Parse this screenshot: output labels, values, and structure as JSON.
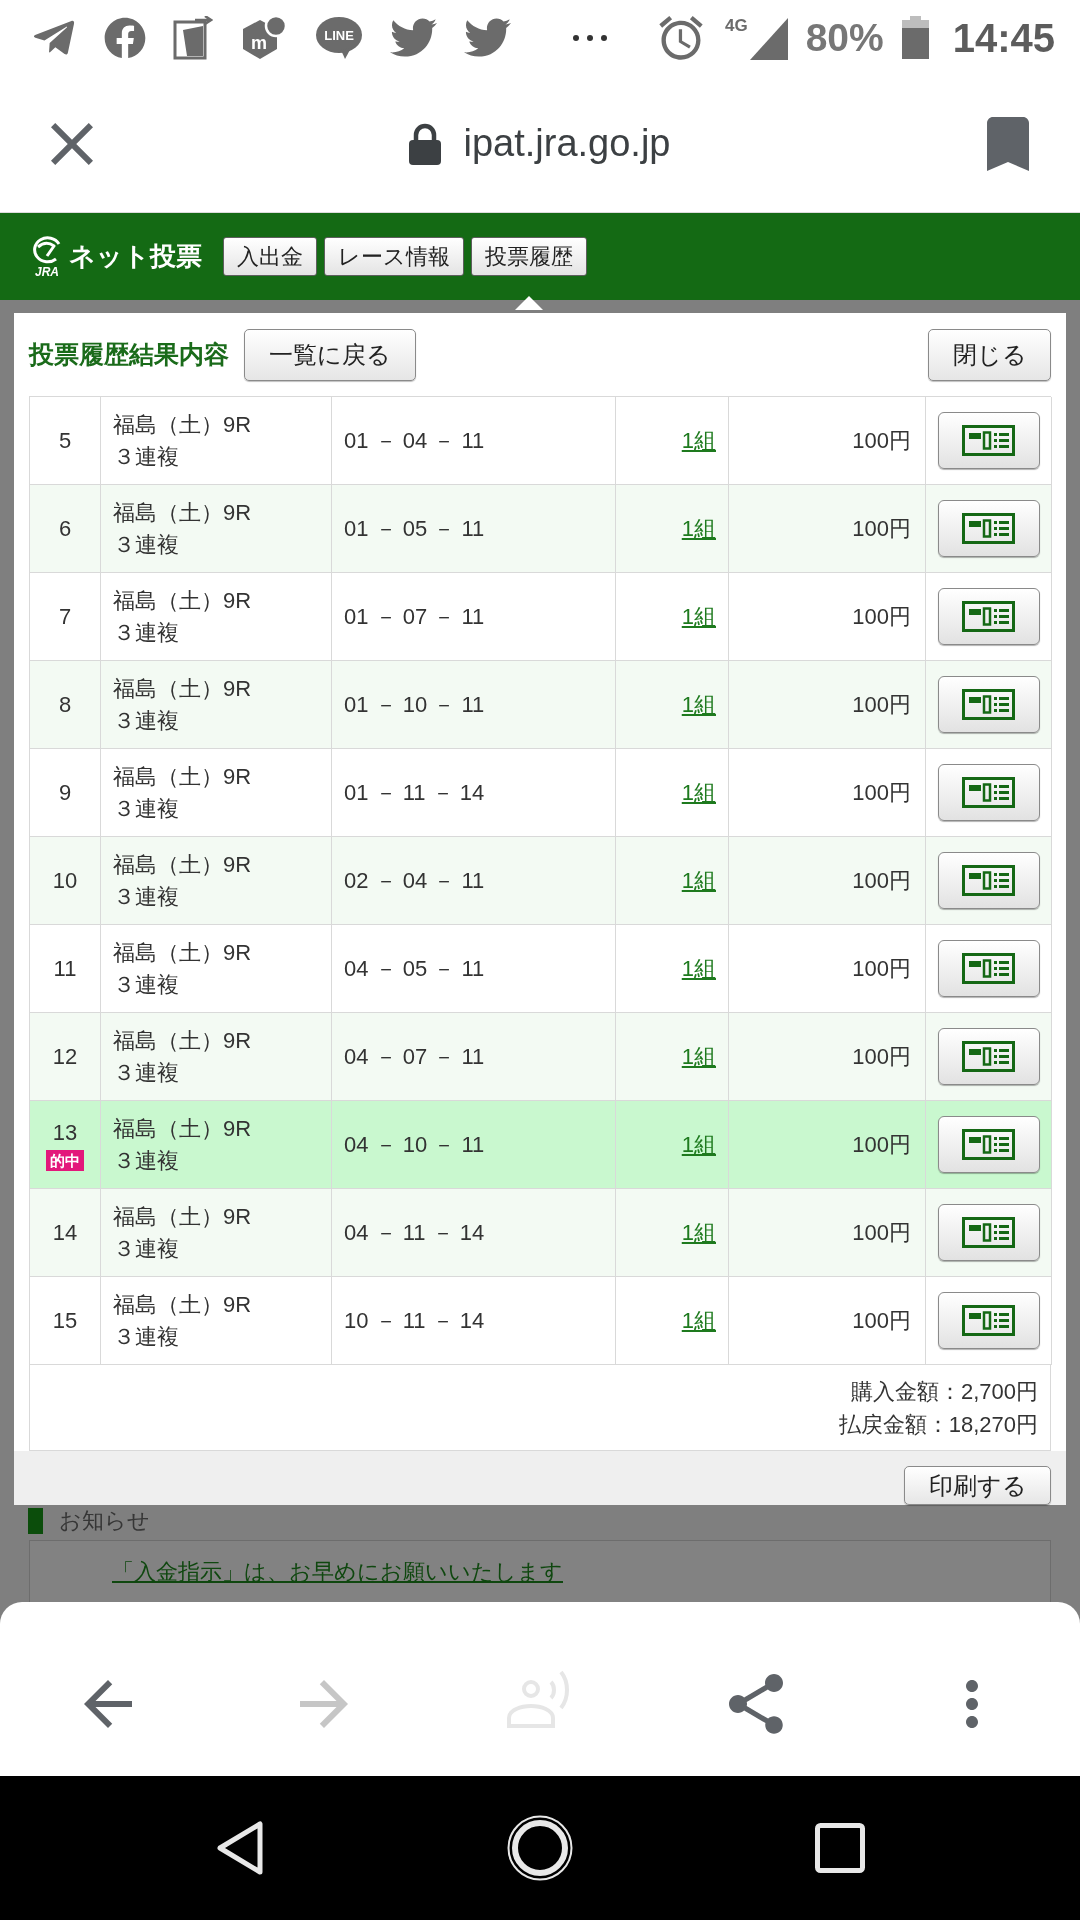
{
  "status_bar": {
    "hexagon_icon_letter": "m",
    "chat_icon_label": "LINE",
    "network": "4G",
    "battery": "80%",
    "time": "14:45"
  },
  "address_bar": {
    "url": "ipat.jra.go.jp"
  },
  "site_header": {
    "logo_caption": "JRA",
    "logo_title": "ネット投票",
    "nav": [
      {
        "label": "入出金",
        "selected": false
      },
      {
        "label": "レース情報",
        "selected": false
      },
      {
        "label": "投票履歴",
        "selected": true
      }
    ]
  },
  "dialog": {
    "title": "投票履歴結果内容",
    "back_button": "一覧に戻る",
    "close_button": "閉じる",
    "rows": [
      {
        "no": "5",
        "race": "福島（土）9R",
        "bet_type": "３連複",
        "combination": "01 － 04 － 11",
        "count": "1組",
        "amount": "100円",
        "hit": false
      },
      {
        "no": "6",
        "race": "福島（土）9R",
        "bet_type": "３連複",
        "combination": "01 － 05 － 11",
        "count": "1組",
        "amount": "100円",
        "hit": false
      },
      {
        "no": "7",
        "race": "福島（土）9R",
        "bet_type": "３連複",
        "combination": "01 － 07 － 11",
        "count": "1組",
        "amount": "100円",
        "hit": false
      },
      {
        "no": "8",
        "race": "福島（土）9R",
        "bet_type": "３連複",
        "combination": "01 － 10 － 11",
        "count": "1組",
        "amount": "100円",
        "hit": false
      },
      {
        "no": "9",
        "race": "福島（土）9R",
        "bet_type": "３連複",
        "combination": "01 － 11 － 14",
        "count": "1組",
        "amount": "100円",
        "hit": false
      },
      {
        "no": "10",
        "race": "福島（土）9R",
        "bet_type": "３連複",
        "combination": "02 － 04 － 11",
        "count": "1組",
        "amount": "100円",
        "hit": false
      },
      {
        "no": "11",
        "race": "福島（土）9R",
        "bet_type": "３連複",
        "combination": "04 － 05 － 11",
        "count": "1組",
        "amount": "100円",
        "hit": false
      },
      {
        "no": "12",
        "race": "福島（土）9R",
        "bet_type": "３連複",
        "combination": "04 － 07 － 11",
        "count": "1組",
        "amount": "100円",
        "hit": false
      },
      {
        "no": "13",
        "badge": "的中",
        "race": "福島（土）9R",
        "bet_type": "３連複",
        "combination": "04 － 10 － 11",
        "count": "1組",
        "amount": "100円",
        "hit": true
      },
      {
        "no": "14",
        "race": "福島（土）9R",
        "bet_type": "３連複",
        "combination": "04 － 11 － 14",
        "count": "1組",
        "amount": "100円",
        "hit": false
      },
      {
        "no": "15",
        "race": "福島（土）9R",
        "bet_type": "３連複",
        "combination": "10 － 11 － 14",
        "count": "1組",
        "amount": "100円",
        "hit": false
      }
    ],
    "totals": [
      "購入金額：2,700円",
      "払戻金額：18,270円"
    ],
    "print_button": "印刷する"
  },
  "notices": {
    "heading": "お知らせ",
    "link": "「入金指示」は、お早めにお願いいたします"
  },
  "browser_toolbar": [
    {
      "kind": "back",
      "disabled": false
    },
    {
      "kind": "forward",
      "disabled": true
    },
    {
      "kind": "listen",
      "disabled": true
    },
    {
      "kind": "share",
      "disabled": false
    },
    {
      "kind": "more",
      "disabled": false
    }
  ]
}
